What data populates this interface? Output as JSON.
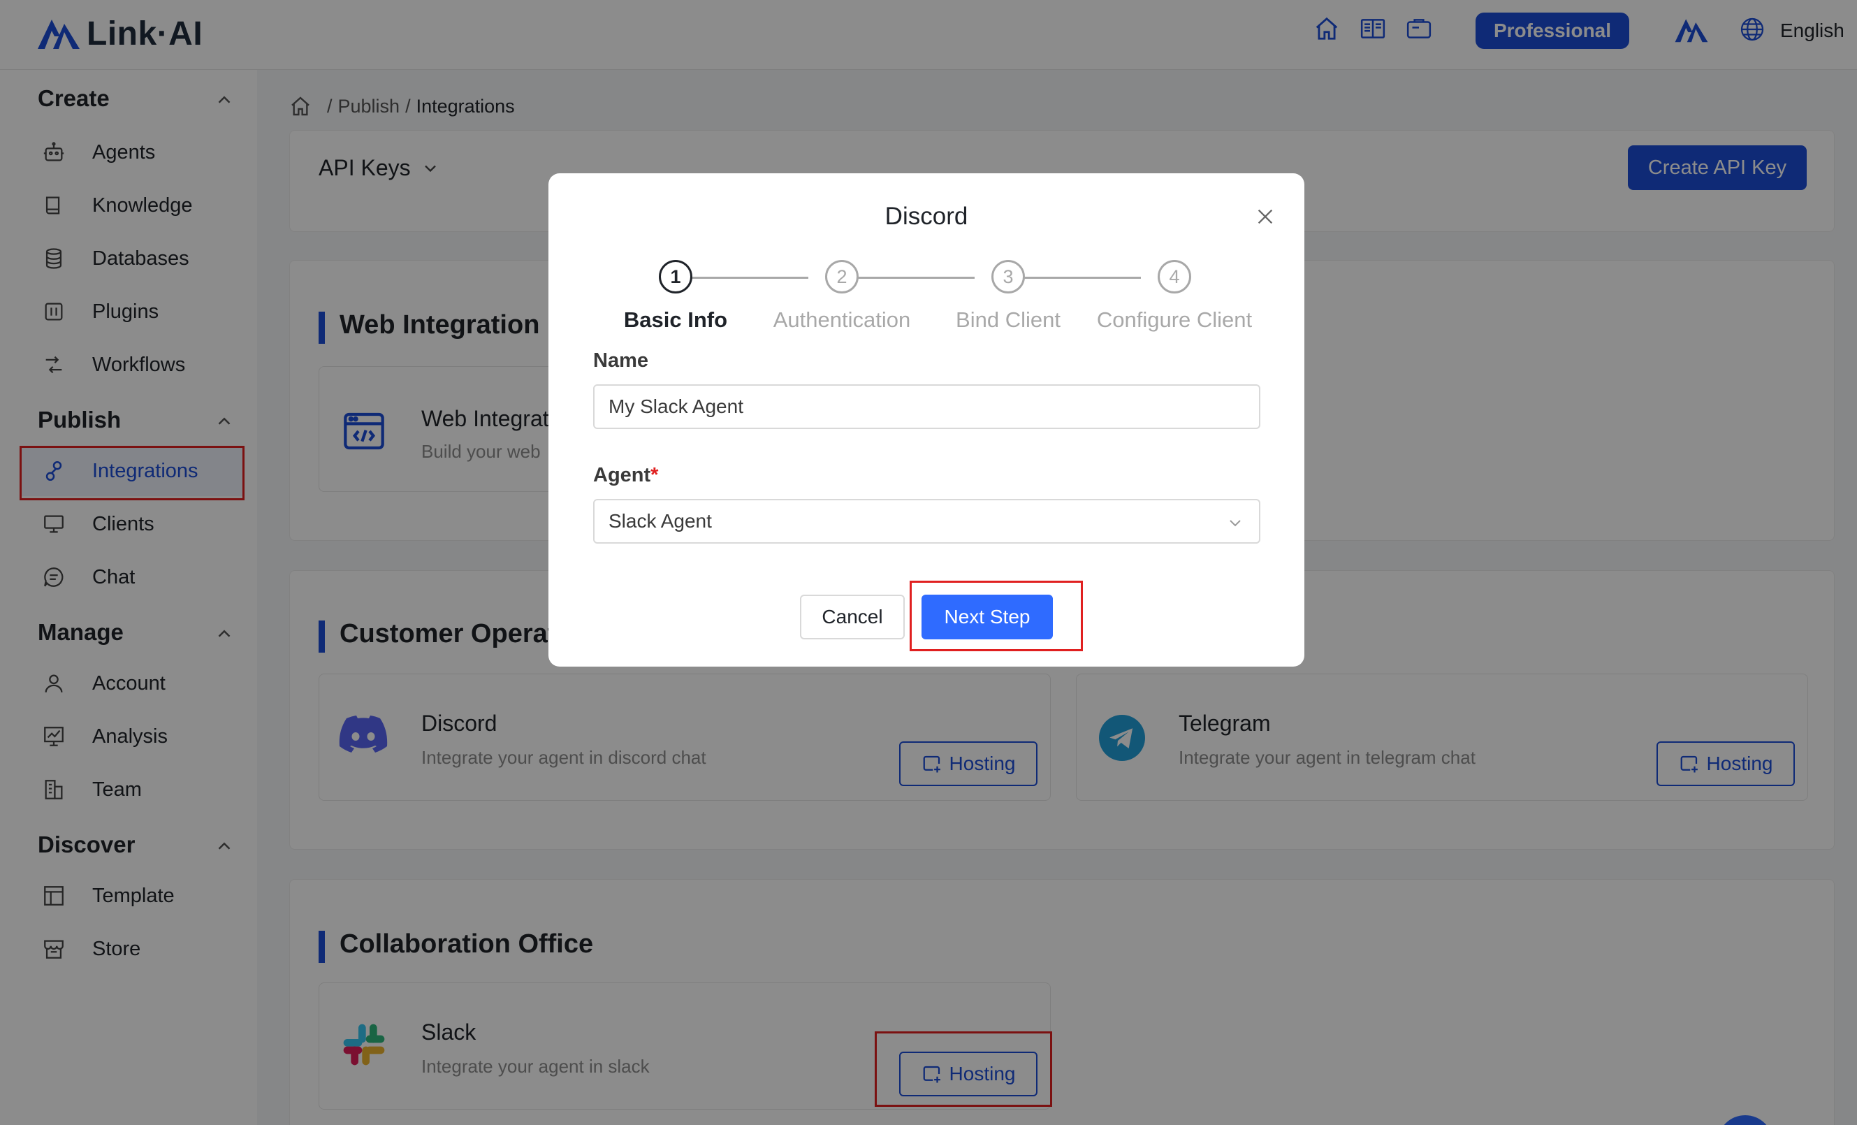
{
  "header": {
    "logo_text": "Link·AI",
    "plan_badge": "Professional",
    "language": "English",
    "brand_color": "#1d4ed8"
  },
  "sidebar": {
    "sections": [
      {
        "title": "Create",
        "items": [
          {
            "label": "Agents",
            "icon": "robot-icon"
          },
          {
            "label": "Knowledge",
            "icon": "book-icon"
          },
          {
            "label": "Databases",
            "icon": "database-icon"
          },
          {
            "label": "Plugins",
            "icon": "plugin-icon"
          },
          {
            "label": "Workflows",
            "icon": "workflow-icon"
          }
        ]
      },
      {
        "title": "Publish",
        "items": [
          {
            "label": "Integrations",
            "icon": "link-icon",
            "active": true
          },
          {
            "label": "Clients",
            "icon": "monitor-icon"
          },
          {
            "label": "Chat",
            "icon": "chat-icon"
          }
        ]
      },
      {
        "title": "Manage",
        "items": [
          {
            "label": "Account",
            "icon": "user-icon"
          },
          {
            "label": "Analysis",
            "icon": "chart-icon"
          },
          {
            "label": "Team",
            "icon": "team-icon"
          }
        ]
      },
      {
        "title": "Discover",
        "items": [
          {
            "label": "Template",
            "icon": "template-icon"
          },
          {
            "label": "Store",
            "icon": "store-icon"
          }
        ]
      }
    ]
  },
  "breadcrumb": {
    "items": [
      "Publish",
      "Integrations"
    ],
    "sep": "/"
  },
  "main": {
    "api_keys_label": "API Keys",
    "create_api_key": "Create API Key",
    "web_group": {
      "title": "Web Integration",
      "card": {
        "name": "Web Integrat",
        "desc": "Build your web"
      }
    },
    "customer_group": {
      "title": "Customer Operat",
      "cards": [
        {
          "name": "Discord",
          "desc": "Integrate your agent in discord chat",
          "button": "Hosting"
        },
        {
          "name": "Telegram",
          "desc": "Integrate your agent in telegram chat",
          "button": "Hosting"
        }
      ]
    },
    "collab_group": {
      "title": "Collaboration Office",
      "cards": [
        {
          "name": "Slack",
          "desc": "Integrate your agent in slack",
          "button": "Hosting"
        }
      ]
    }
  },
  "modal": {
    "title": "Discord",
    "steps": [
      {
        "num": "1",
        "label": "Basic Info",
        "active": true
      },
      {
        "num": "2",
        "label": "Authentication"
      },
      {
        "num": "3",
        "label": "Bind Client"
      },
      {
        "num": "4",
        "label": "Configure Client"
      }
    ],
    "name_label": "Name",
    "name_value": "My Slack Agent",
    "agent_label": "Agent",
    "agent_required": "*",
    "agent_value": "Slack Agent",
    "cancel": "Cancel",
    "next": "Next Step"
  }
}
